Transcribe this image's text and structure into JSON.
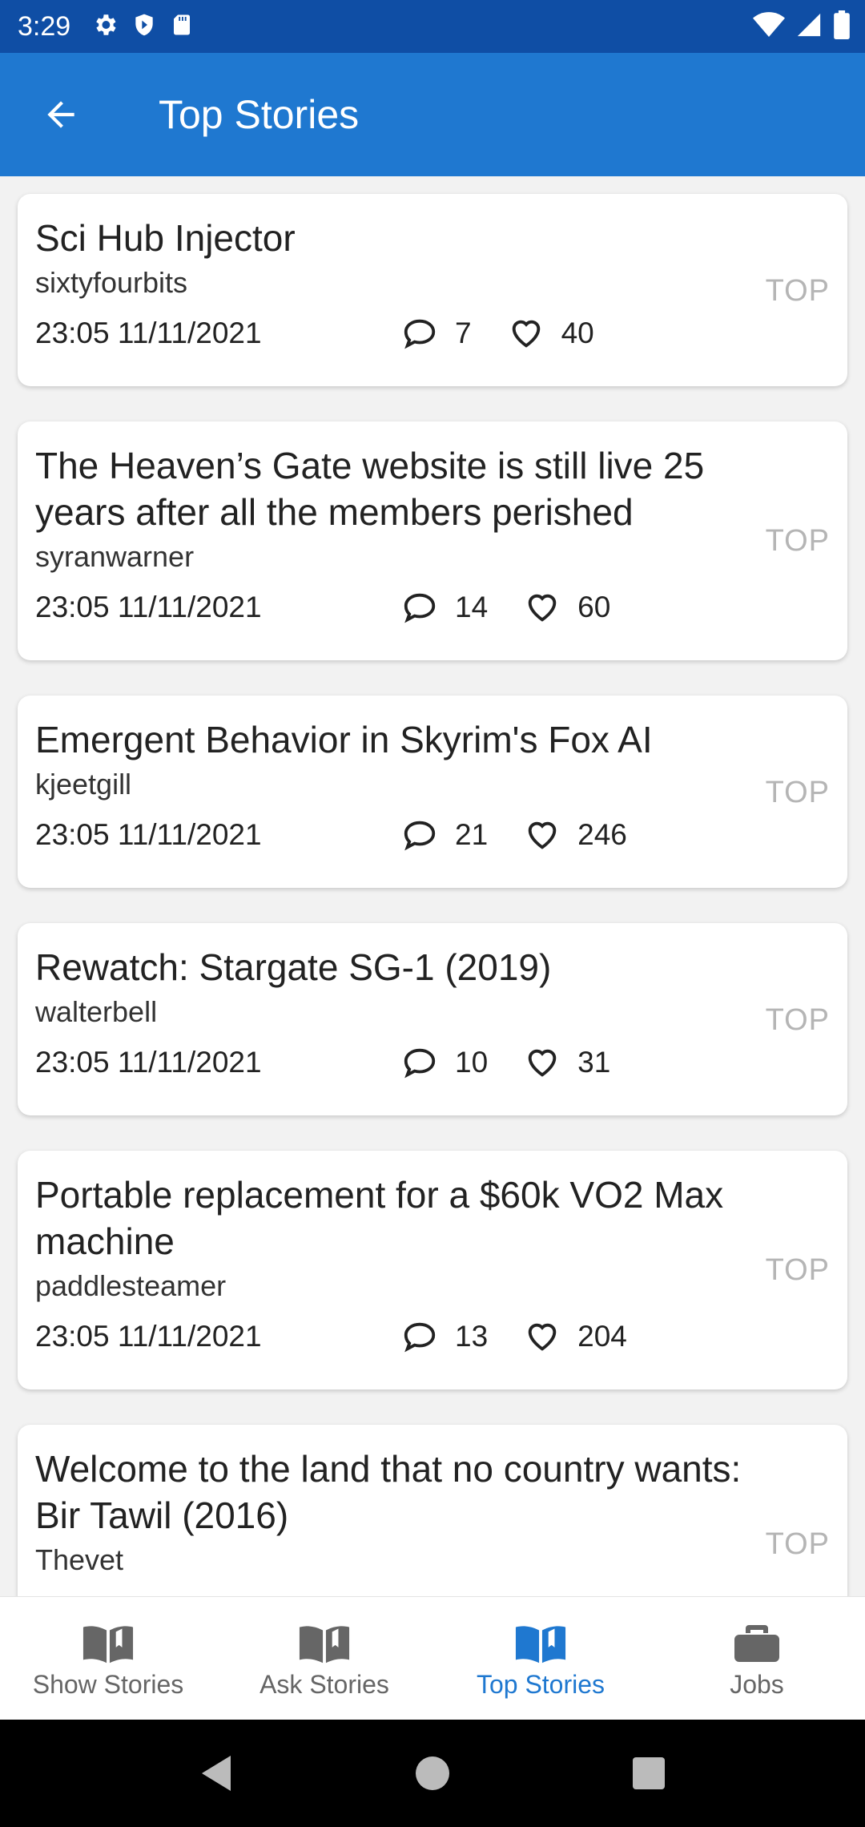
{
  "status": {
    "time": "3:29"
  },
  "appbar": {
    "title": "Top Stories"
  },
  "stories": [
    {
      "title": "Sci Hub Injector",
      "author": "sixtyfourbits",
      "time": "23:05 11/11/2021",
      "comments": "7",
      "likes": "40",
      "tag": "TOP"
    },
    {
      "title": "The Heaven’s Gate website is still live 25 years after all the members perished",
      "author": "syranwarner",
      "time": "23:05 11/11/2021",
      "comments": "14",
      "likes": "60",
      "tag": "TOP"
    },
    {
      "title": "Emergent Behavior in Skyrim's Fox AI",
      "author": "kjeetgill",
      "time": "23:05 11/11/2021",
      "comments": "21",
      "likes": "246",
      "tag": "TOP"
    },
    {
      "title": "Rewatch: Stargate SG-1 (2019)",
      "author": "walterbell",
      "time": "23:05 11/11/2021",
      "comments": "10",
      "likes": "31",
      "tag": "TOP"
    },
    {
      "title": "Portable replacement for a $60k VO2 Max machine",
      "author": "paddlesteamer",
      "time": "23:05 11/11/2021",
      "comments": "13",
      "likes": "204",
      "tag": "TOP"
    },
    {
      "title": "Welcome to the land that no country wants: Bir Tawil (2016)",
      "author": "Thevet",
      "tag": "TOP"
    }
  ],
  "nav": {
    "items": [
      {
        "label": "Show Stories",
        "icon": "book-icon"
      },
      {
        "label": "Ask Stories",
        "icon": "book-icon"
      },
      {
        "label": "Top Stories",
        "icon": "book-icon",
        "active": true
      },
      {
        "label": "Jobs",
        "icon": "briefcase-icon"
      }
    ]
  },
  "colors": {
    "status_bar": "#0f4ea5",
    "app_bar": "#1f78d0",
    "accent": "#1f78d0",
    "tag": "#b5b5b5"
  }
}
